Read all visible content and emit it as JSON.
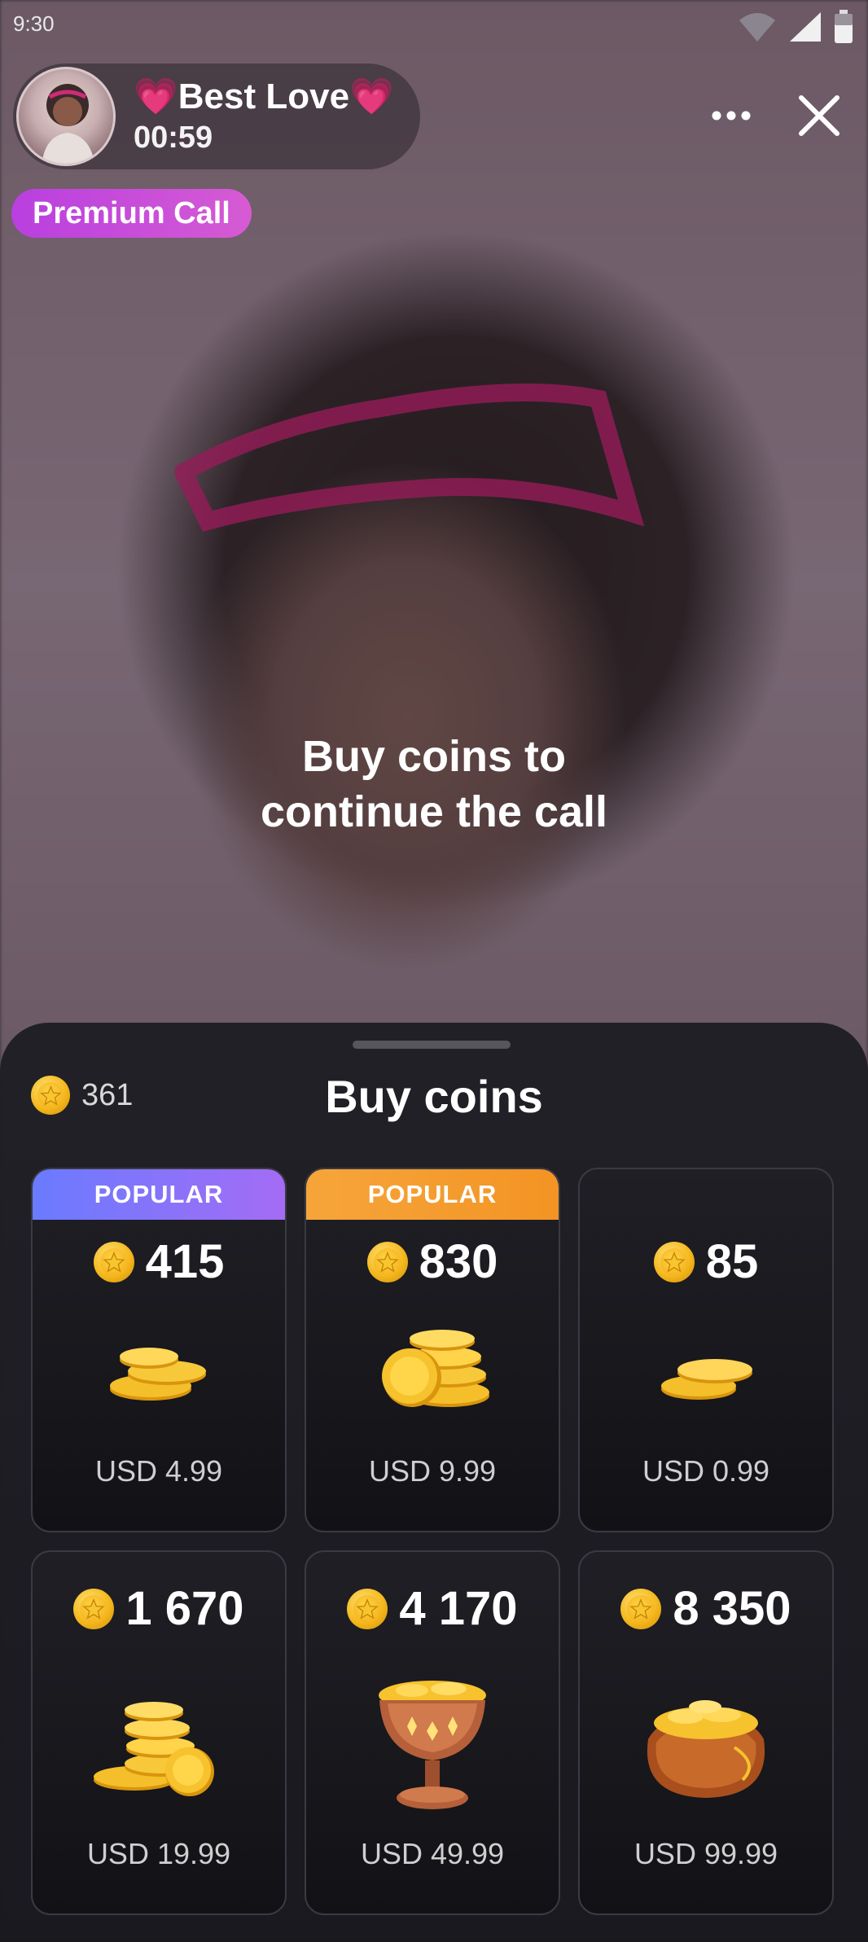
{
  "status_bar": {
    "time": "9:30"
  },
  "caller": {
    "name": "💗Best Love💗",
    "timer": "00:59"
  },
  "premium_badge": "Premium Call",
  "center_message": [
    "Buy coins to",
    "continue the call"
  ],
  "sheet": {
    "title": "Buy coins",
    "balance": "361",
    "packages": [
      {
        "tag": "POPULAR",
        "tag_color": "#8a74fa",
        "amount": "415",
        "price": "USD 4.99"
      },
      {
        "tag": "POPULAR",
        "tag_color": "#f59a2c",
        "amount": "830",
        "price": "USD 9.99"
      },
      {
        "tag": "",
        "amount": "85",
        "price": "USD 0.99"
      },
      {
        "tag": "",
        "amount": "1 670",
        "price": "USD 19.99"
      },
      {
        "tag": "",
        "amount": "4 170",
        "price": "USD 49.99"
      },
      {
        "tag": "",
        "amount": "8 350",
        "price": "USD 99.99"
      }
    ]
  },
  "colors": {
    "premium": "#c94be0",
    "coin": "#f5b81d",
    "sheet_bg": "#1e1e24"
  },
  "icons": [
    "wifi-icon",
    "signal-icon",
    "battery-icon",
    "more-icon",
    "close-icon",
    "coin-icon"
  ]
}
